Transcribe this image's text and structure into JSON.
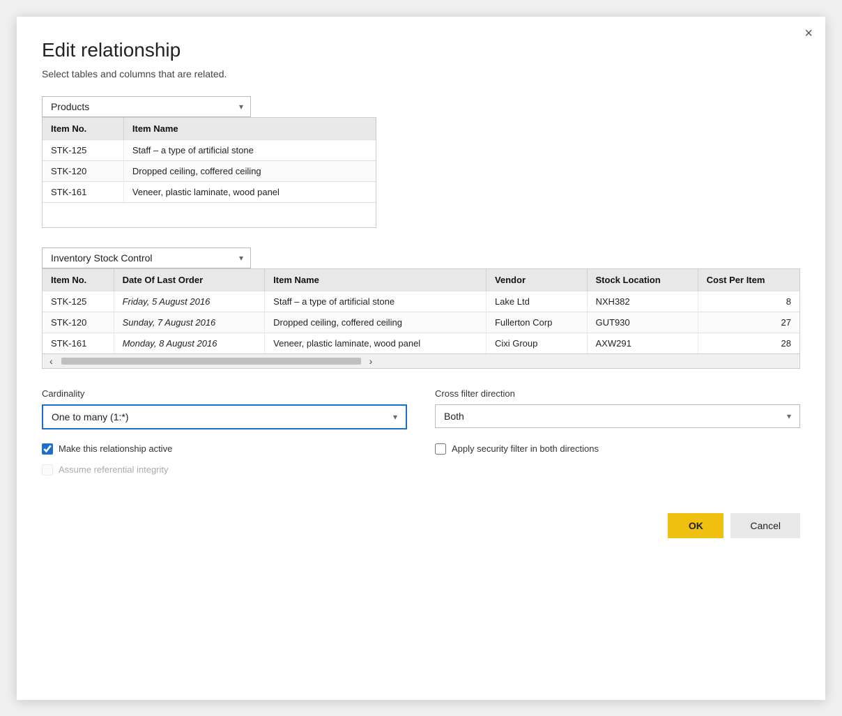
{
  "dialog": {
    "title": "Edit relationship",
    "subtitle": "Select tables and columns that are related.",
    "close_label": "×"
  },
  "table1": {
    "dropdown_label": "Products",
    "columns": [
      "Item No.",
      "Item Name"
    ],
    "rows": [
      [
        "STK-125",
        "Staff – a type of artificial stone"
      ],
      [
        "STK-120",
        "Dropped ceiling, coffered ceiling"
      ],
      [
        "STK-161",
        "Veneer, plastic laminate, wood panel"
      ]
    ]
  },
  "table2": {
    "dropdown_label": "Inventory Stock Control",
    "columns": [
      "Item No.",
      "Date Of Last Order",
      "Item Name",
      "Vendor",
      "Stock Location",
      "Cost Per Item"
    ],
    "rows": [
      [
        "STK-125",
        "Friday, 5 August 2016",
        "Staff – a type of artificial stone",
        "Lake Ltd",
        "NXH382",
        "8"
      ],
      [
        "STK-120",
        "Sunday, 7 August 2016",
        "Dropped ceiling, coffered ceiling",
        "Fullerton Corp",
        "GUT930",
        "27"
      ],
      [
        "STK-161",
        "Monday, 8 August 2016",
        "Veneer, plastic laminate, wood panel",
        "Cixi Group",
        "AXW291",
        "28"
      ]
    ]
  },
  "cardinality": {
    "label": "Cardinality",
    "value": "One to many (1:*)"
  },
  "cross_filter": {
    "label": "Cross filter direction",
    "value": "Both"
  },
  "checkboxes": {
    "make_active_label": "Make this relationship active",
    "make_active_checked": true,
    "assume_integrity_label": "Assume referential integrity",
    "assume_integrity_checked": false,
    "assume_integrity_disabled": true,
    "apply_security_label": "Apply security filter in both directions",
    "apply_security_checked": false
  },
  "buttons": {
    "ok_label": "OK",
    "cancel_label": "Cancel"
  }
}
